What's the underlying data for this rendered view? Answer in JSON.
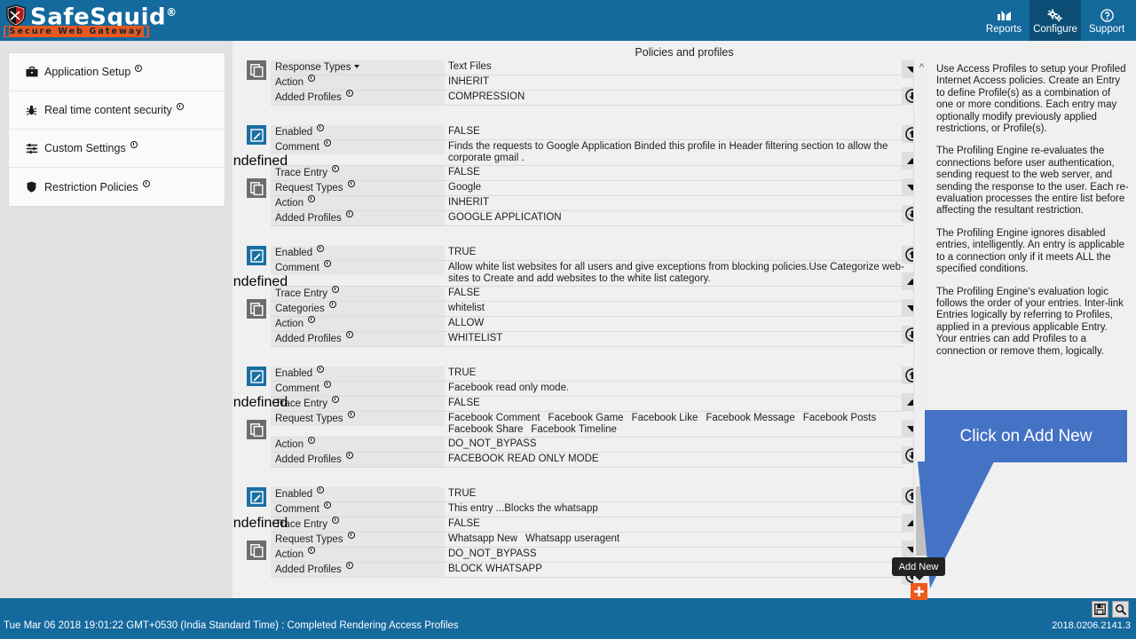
{
  "header": {
    "logo_name": "SafeSquid",
    "logo_reg": "®",
    "logo_tagline": "Secure Web Gateway",
    "nav": [
      {
        "label": "Reports",
        "icon": "chart-icon",
        "active": false
      },
      {
        "label": "Configure",
        "icon": "gears-icon",
        "active": true
      },
      {
        "label": "Support",
        "icon": "help-circle-icon",
        "active": false
      }
    ]
  },
  "sidebar": {
    "items": [
      {
        "label": "Application Setup",
        "icon": "briefcase-icon"
      },
      {
        "label": "Real time content security",
        "icon": "bug-shield-icon"
      },
      {
        "label": "Custom Settings",
        "icon": "sliders-icon"
      },
      {
        "label": "Restriction Policies",
        "icon": "shield-icon"
      }
    ]
  },
  "main": {
    "title": "Policies and profiles",
    "row_actions": {
      "edit": "edit-icon",
      "delete": "delete-icon",
      "copy": "copy-icon",
      "move_top": "move-to-top-icon",
      "move_up": "move-up-icon",
      "move_down": "move-down-icon",
      "move_bottom": "move-to-bottom-icon"
    },
    "entries": [
      {
        "partial": true,
        "actions": [
          "copy"
        ],
        "controls": [
          "move_down",
          "move_bottom"
        ],
        "rows": [
          {
            "label": "Response Types",
            "badge": "caret",
            "value": "Text Files"
          },
          {
            "label": "Action",
            "badge": "info",
            "value": "INHERIT"
          },
          {
            "label": "Added Profiles",
            "badge": "info",
            "value": "COMPRESSION"
          }
        ]
      },
      {
        "partial": false,
        "actions": [
          "edit",
          "delete",
          "copy"
        ],
        "controls": [
          "move_top",
          "move_up",
          "move_down",
          "move_bottom"
        ],
        "rows": [
          {
            "label": "Enabled",
            "badge": "info",
            "value": "FALSE"
          },
          {
            "label": "Comment",
            "badge": "info",
            "value": "Finds the requests to Google Application Binded this profile in Header filtering section to allow the corporate gmail ."
          },
          {
            "label": "Trace Entry",
            "badge": "info",
            "value": "FALSE"
          },
          {
            "label": "Request Types",
            "badge": "info",
            "value": "Google"
          },
          {
            "label": "Action",
            "badge": "info",
            "value": "INHERIT"
          },
          {
            "label": "Added Profiles",
            "badge": "info",
            "value": "GOOGLE APPLICATION"
          }
        ]
      },
      {
        "partial": false,
        "actions": [
          "edit",
          "delete",
          "copy"
        ],
        "controls": [
          "move_top",
          "move_up",
          "move_down",
          "move_bottom"
        ],
        "rows": [
          {
            "label": "Enabled",
            "badge": "info",
            "value": "TRUE"
          },
          {
            "label": "Comment",
            "badge": "info",
            "value": "Allow white list websites for all users and give exceptions from blocking policies.Use Categorize web-sites to Create and add websites to the white list category."
          },
          {
            "label": "Trace Entry",
            "badge": "info",
            "value": "FALSE"
          },
          {
            "label": "Categories",
            "badge": "info",
            "value": "whitelist"
          },
          {
            "label": "Action",
            "badge": "info",
            "value": "ALLOW"
          },
          {
            "label": "Added Profiles",
            "badge": "info",
            "value": "WHITELIST"
          }
        ]
      },
      {
        "partial": false,
        "actions": [
          "edit",
          "delete",
          "copy"
        ],
        "controls": [
          "move_top",
          "move_up",
          "move_down",
          "move_bottom"
        ],
        "rows": [
          {
            "label": "Enabled",
            "badge": "info",
            "value": "TRUE"
          },
          {
            "label": "Comment",
            "badge": "info",
            "value": "Facebook read only mode."
          },
          {
            "label": "Trace Entry",
            "badge": "info",
            "value": "FALSE"
          },
          {
            "label": "Request Types",
            "badge": "info",
            "value": "",
            "fragments": [
              "Facebook Comment",
              "Facebook Game",
              "Facebook Like",
              "Facebook Message",
              "Facebook Posts",
              "Facebook Share",
              "Facebook Timeline"
            ]
          },
          {
            "label": "Action",
            "badge": "info",
            "value": "DO_NOT_BYPASS"
          },
          {
            "label": "Added Profiles",
            "badge": "info",
            "value": "FACEBOOK READ ONLY MODE"
          }
        ]
      },
      {
        "partial": false,
        "actions": [
          "edit",
          "delete",
          "copy"
        ],
        "controls": [
          "move_top",
          "move_up",
          "move_down",
          "move_bottom"
        ],
        "rows": [
          {
            "label": "Enabled",
            "badge": "info",
            "value": "TRUE"
          },
          {
            "label": "Comment",
            "badge": "info",
            "value": "This entry ...Blocks the whatsapp"
          },
          {
            "label": "Trace Entry",
            "badge": "info",
            "value": "FALSE"
          },
          {
            "label": "Request Types",
            "badge": "info",
            "value": "",
            "fragments": [
              "Whatsapp New",
              "Whatsapp useragent"
            ]
          },
          {
            "label": "Action",
            "badge": "info",
            "value": "DO_NOT_BYPASS"
          },
          {
            "label": "Added Profiles",
            "badge": "info",
            "value": "BLOCK WHATSAPP"
          }
        ]
      }
    ]
  },
  "help": {
    "paragraphs": [
      "Use Access Profiles to setup your Profiled Internet Access policies. Create an Entry to define Profile(s) as a combination of one or more conditions. Each entry may optionally modify previously applied restrictions, or Profile(s).",
      "The Profiling Engine re-evaluates the connections before user authentication, sending request to the web server, and sending the response to the user. Each re-evaluation processes the entire list before affecting the resultant restriction.",
      "The Profiling Engine ignores disabled entries, intelligently. An entry is applicable to a connection only if it meets ALL the specified conditions.",
      "The Profiling Engine's evaluation logic follows the order of your entries. Inter-link Entries logically by referring to Profiles, applied in a previous applicable Entry. Your entries can add Profiles to a connection or remove them, logically."
    ]
  },
  "callout": {
    "text": "Click on Add New",
    "color": "#4472c4"
  },
  "add_new": {
    "tooltip": "Add New",
    "icon": "plus-icon",
    "color": "#f05a1e"
  },
  "footer": {
    "status": "Tue Mar 06 2018 19:01:22 GMT+0530 (India Standard Time) : Completed Rendering Access Profiles",
    "version": "2018.0206.2141.3",
    "icons": [
      {
        "name": "save-icon"
      },
      {
        "name": "search-icon"
      }
    ]
  }
}
